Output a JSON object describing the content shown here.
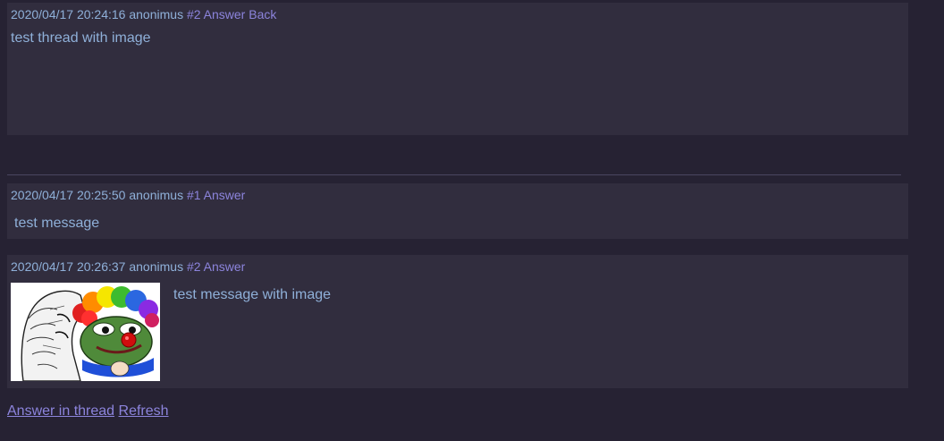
{
  "posts": [
    {
      "date": "2020/04/17 20:24:16",
      "author": "anonimus",
      "number": "#2",
      "actions": "Answer Back",
      "text": "test thread with image"
    },
    {
      "date": "2020/04/17 20:25:50",
      "author": "anonimus",
      "number": "#1",
      "actions": "Answer",
      "text": "test message"
    },
    {
      "date": "2020/04/17 20:26:37",
      "author": "anonimus",
      "number": "#2",
      "actions": "Answer",
      "text": "test message with image"
    }
  ],
  "footer": {
    "answer_in_thread": "Answer in thread",
    "refresh": "Refresh"
  },
  "colors": {
    "background": "#262233",
    "post_background": "#312d3e",
    "text": "#8fb0d9",
    "link": "#8c84dc"
  }
}
